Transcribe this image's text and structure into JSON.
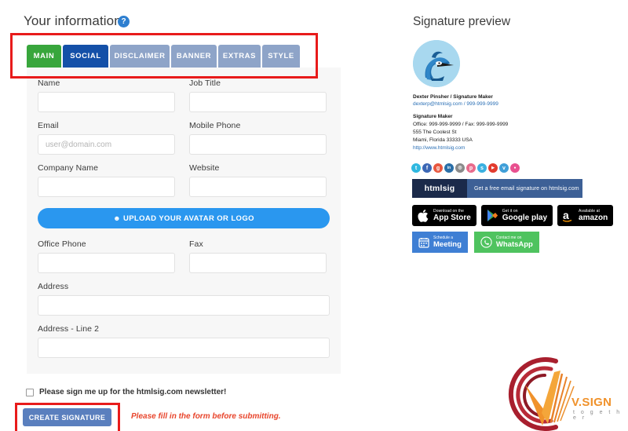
{
  "form": {
    "title": "Your information",
    "help_icon": "question-mark-icon",
    "tabs": [
      {
        "label": "MAIN",
        "active": true,
        "color": "#38a63c"
      },
      {
        "label": "SOCIAL",
        "active": true,
        "color": "#1450a8"
      },
      {
        "label": "DISCLAIMER",
        "active": false,
        "color": "#8ea4c8"
      },
      {
        "label": "BANNER",
        "active": false,
        "color": "#8ea4c8"
      },
      {
        "label": "EXTRAS",
        "active": false,
        "color": "#8ea4c8"
      },
      {
        "label": "STYLE",
        "active": false,
        "color": "#8ea4c8"
      }
    ],
    "fields": {
      "name": {
        "label": "Name",
        "value": "",
        "placeholder": ""
      },
      "job_title": {
        "label": "Job Title",
        "value": "",
        "placeholder": ""
      },
      "email": {
        "label": "Email",
        "value": "",
        "placeholder": "user@domain.com"
      },
      "mobile_phone": {
        "label": "Mobile Phone",
        "value": "",
        "placeholder": ""
      },
      "company_name": {
        "label": "Company Name",
        "value": "",
        "placeholder": ""
      },
      "website": {
        "label": "Website",
        "value": "",
        "placeholder": ""
      },
      "office_phone": {
        "label": "Office Phone",
        "value": "",
        "placeholder": ""
      },
      "fax": {
        "label": "Fax",
        "value": "",
        "placeholder": ""
      },
      "address": {
        "label": "Address",
        "value": "",
        "placeholder": ""
      },
      "address_line2": {
        "label": "Address - Line 2",
        "value": "",
        "placeholder": ""
      }
    },
    "upload_button": {
      "label": "UPLOAD YOUR AVATAR OR LOGO",
      "icon": "upload-icon"
    },
    "newsletter": {
      "label": "Please sign me up for the htmlsig.com newsletter!",
      "checked": false
    },
    "submit_button": {
      "label": "CREATE SIGNATURE",
      "enabled": false
    },
    "validation_message": "Please fill in the form before submitting."
  },
  "preview": {
    "title": "Signature preview",
    "avatar_icon": "blue-jay-bird-avatar",
    "signature": {
      "name_line": "Dexter Pinsher / Signature Maker",
      "contact_line": "dexterp@htmlsig.com / 999-999-9999",
      "company": "Signature Maker",
      "phones": "Office: 999-999-9999 / Fax: 999-999-9999",
      "street": "555 The Coolest St",
      "city": "Miami, Florida 33333 USA",
      "url": "http://www.htmlsig.com"
    },
    "social_icons": [
      {
        "name": "twitter-icon",
        "glyph": "t",
        "color": "#2fb8e0"
      },
      {
        "name": "facebook-icon",
        "glyph": "f",
        "color": "#3b67b5"
      },
      {
        "name": "google-plus-icon",
        "glyph": "g",
        "color": "#e8573f"
      },
      {
        "name": "linkedin-icon",
        "glyph": "in",
        "color": "#2a6fa8"
      },
      {
        "name": "instagram-icon",
        "glyph": "◉",
        "color": "#8a8a8a"
      },
      {
        "name": "pinterest-icon",
        "glyph": "p",
        "color": "#e86b8c"
      },
      {
        "name": "skype-icon",
        "glyph": "s",
        "color": "#3ab0e0"
      },
      {
        "name": "youtube-icon",
        "glyph": "▶",
        "color": "#e23b2e"
      },
      {
        "name": "vimeo-icon",
        "glyph": "v",
        "color": "#3f9fd8"
      },
      {
        "name": "flickr-icon",
        "glyph": "●",
        "color": "#e8508f"
      }
    ],
    "banner": {
      "logo": "htmlsig",
      "text": "Get a free email signature on htmlsig.com",
      "logo_color": "#1b2a4a",
      "text_color": "#3d6096"
    },
    "store_badges": [
      {
        "name": "app-store-badge",
        "icon": "apple-icon",
        "small": "Download on the",
        "big": "App Store"
      },
      {
        "name": "google-play-badge",
        "icon": "play-triangle-icon",
        "small": "Get it on",
        "big": "Google play"
      },
      {
        "name": "amazon-badge",
        "icon": "amazon-a-icon",
        "small": "Available at",
        "big": "amazon"
      }
    ],
    "action_buttons": [
      {
        "name": "schedule-meeting-button",
        "icon": "calendar-icon",
        "small": "Schedule a",
        "big": "Meeting",
        "color": "#3f7fd4"
      },
      {
        "name": "whatsapp-button",
        "icon": "whatsapp-phone-icon",
        "small": "Contact me on",
        "big": "WhatsApp",
        "color": "#4fc35f"
      }
    ]
  },
  "watermark": {
    "brand": "V.SIGN",
    "tagline": "t o g e t h e r",
    "arc_color": "#a81f2e",
    "v_color": "#f0922b"
  }
}
